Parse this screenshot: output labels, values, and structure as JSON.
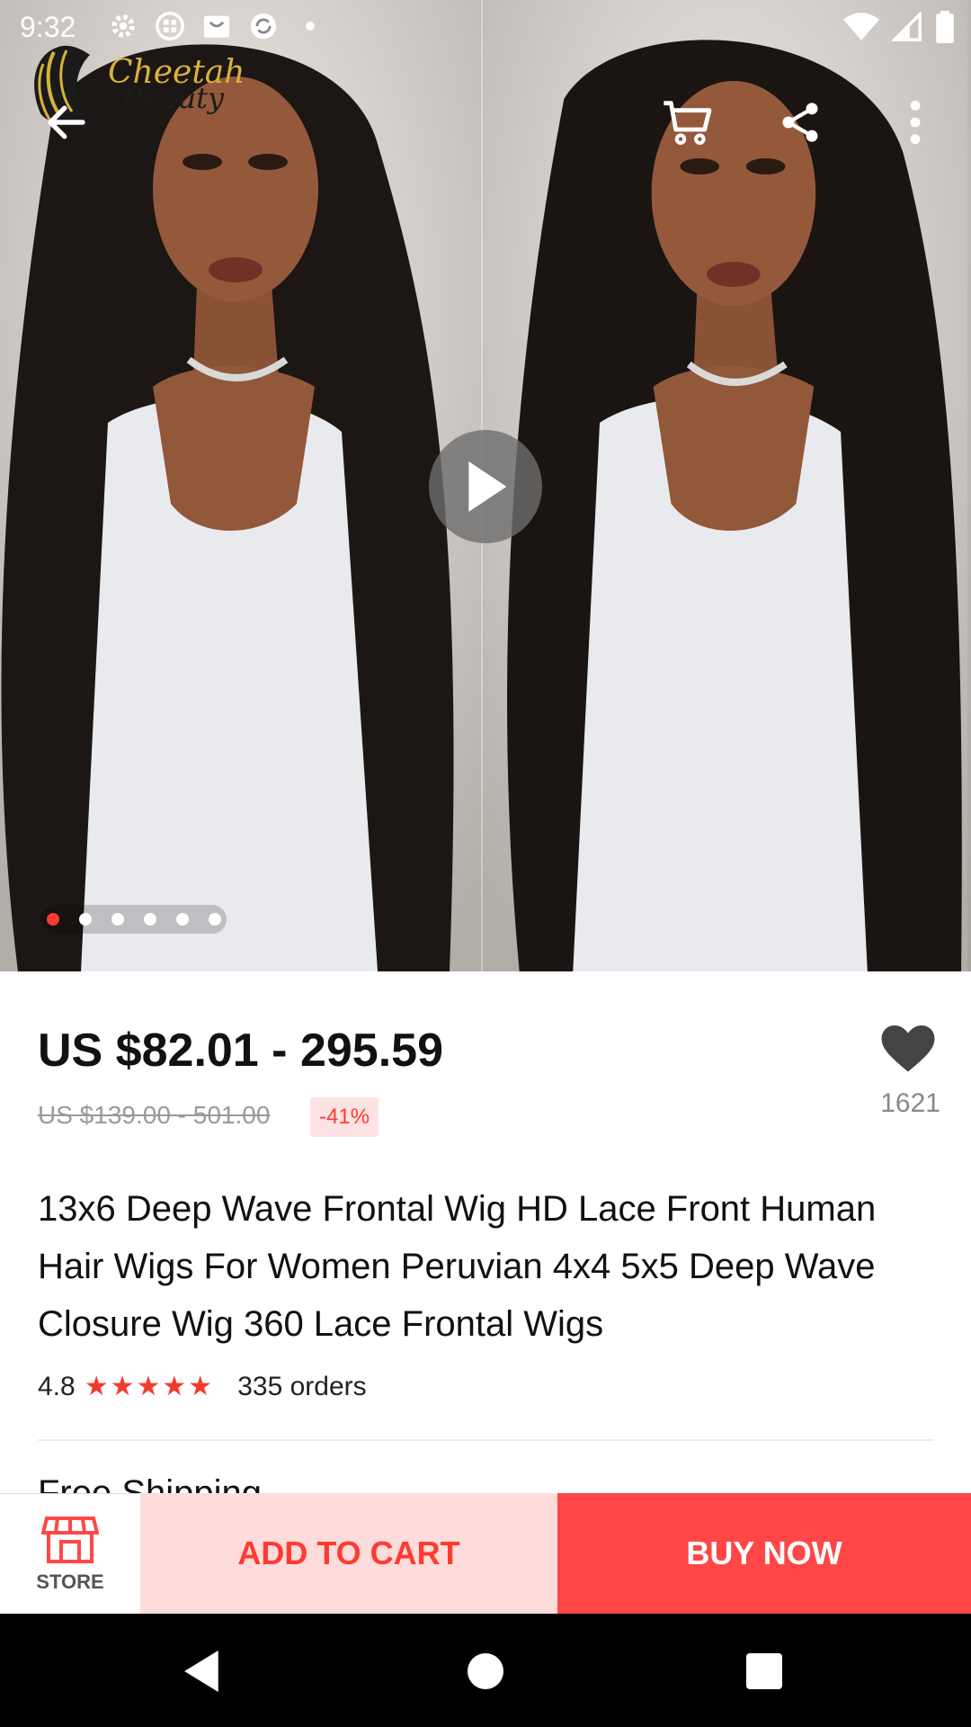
{
  "status_bar": {
    "time": "9:32",
    "icons": [
      "settings-icon",
      "app-grid-icon",
      "shopping-bag-icon",
      "sync-icon",
      "notification-dot-icon"
    ],
    "right_icons": [
      "wifi-icon",
      "signal-icon",
      "battery-icon"
    ]
  },
  "brand": {
    "line1": "Cheetah",
    "line2": "Beauty"
  },
  "gallery": {
    "total_images": 6,
    "active_index": 0
  },
  "product": {
    "price": "US $82.01 - 295.59",
    "original_price": "US $139.00 - 501.00",
    "discount": "-41%",
    "wishlist_count": "1621",
    "title": "13x6 Deep Wave Frontal Wig HD Lace Front Human Hair Wigs For Women Peruvian 4x4 5x5 Deep Wave Closure Wig 360 Lace Frontal Wigs",
    "rating": "4.8",
    "stars": "★★★★★",
    "orders": "335 orders",
    "shipping": "Free Shipping"
  },
  "actions": {
    "store_label": "STORE",
    "add_to_cart": "ADD TO CART",
    "buy_now": "BUY NOW"
  },
  "colors": {
    "accent": "#ff4747",
    "accent_light": "#ffdcdc",
    "discount_text": "#ff3b30"
  }
}
